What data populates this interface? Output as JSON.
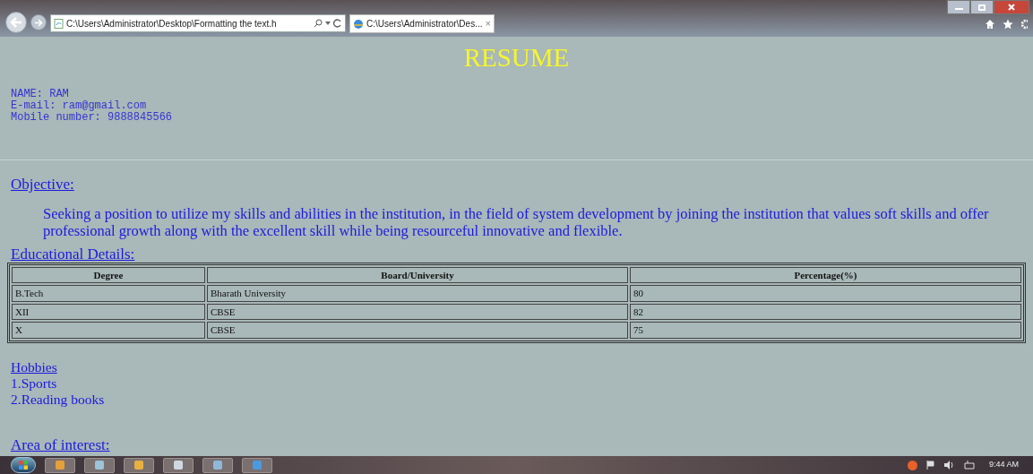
{
  "browser": {
    "address": "C:\\Users\\Administrator\\Desktop\\Formatting the text.h",
    "tab": {
      "title": "C:\\Users\\Administrator\\Des...",
      "close": "×"
    }
  },
  "page": {
    "title": "RESUME",
    "contact": [
      "NAME: RAM",
      "E-mail: ram@gmail.com",
      "Mobile number: 9888845566"
    ],
    "objective": {
      "heading": "Objective:",
      "text": "Seeking a position to utilize my skills and abilities in the institution, in the field of system development by joining the institution that values soft skills and offer professional growth along with the excellent skill while being resourceful innovative and flexible."
    },
    "education": {
      "heading": "Educational Details:",
      "columns": [
        "Degree",
        "Board/University",
        "Percentage(%)"
      ],
      "rows": [
        [
          "B.Tech",
          "Bharath University",
          "80"
        ],
        [
          "XII",
          "CBSE",
          "82"
        ],
        [
          "X",
          "CBSE",
          "75"
        ]
      ]
    },
    "hobbies": {
      "heading": "Hobbies",
      "items": [
        "1.Sports",
        "2.Reading books"
      ]
    },
    "area_heading": "Area of interest:"
  },
  "taskbar": {
    "time": "9:44 AM"
  }
}
